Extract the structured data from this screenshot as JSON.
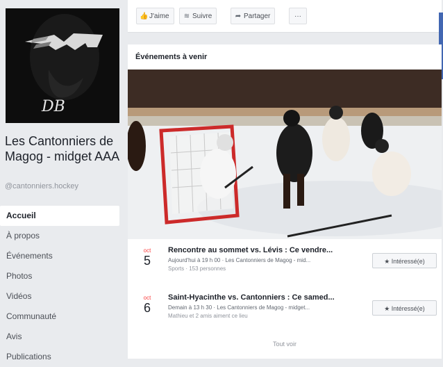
{
  "page": {
    "name": "Les Cantonniers de Magog - midget AAA",
    "handle": "@cantonniers.hockey",
    "logo_text": "DB"
  },
  "nav": [
    "Accueil",
    "À propos",
    "Événements",
    "Photos",
    "Vidéos",
    "Communauté",
    "Avis",
    "Publications"
  ],
  "actions": {
    "like": "J'aime",
    "follow": "Suivre",
    "share": "Partager",
    "more": "···"
  },
  "events": {
    "heading": "Événements à venir",
    "see_all": "Tout voir",
    "items": [
      {
        "month": "oct",
        "day": "5",
        "title": "Rencontre au sommet vs. Lévis : Ce vendre...",
        "when": "Aujourd'hui à 19 h 00 · Les Cantonniers de Magog - mid...",
        "meta": "Sports · 153 personnes",
        "button": "Intéressé(e)"
      },
      {
        "month": "oct",
        "day": "6",
        "title": "Saint-Hyacinthe vs. Cantonniers : Ce samed...",
        "when": "Demain à 13 h 30 · Les Cantonniers de Magog - midget...",
        "meta": "Mathieu et 2 amis aiment ce lieu",
        "button": "Intéressé(e)"
      }
    ]
  },
  "colors": {
    "accent": "#4267b2",
    "date_red": "#fa3e3e",
    "background": "#e9ebee"
  },
  "icons": {
    "like": "thumbs-up-icon",
    "follow": "rss-icon",
    "share": "share-arrow-icon",
    "interested": "star-icon"
  }
}
